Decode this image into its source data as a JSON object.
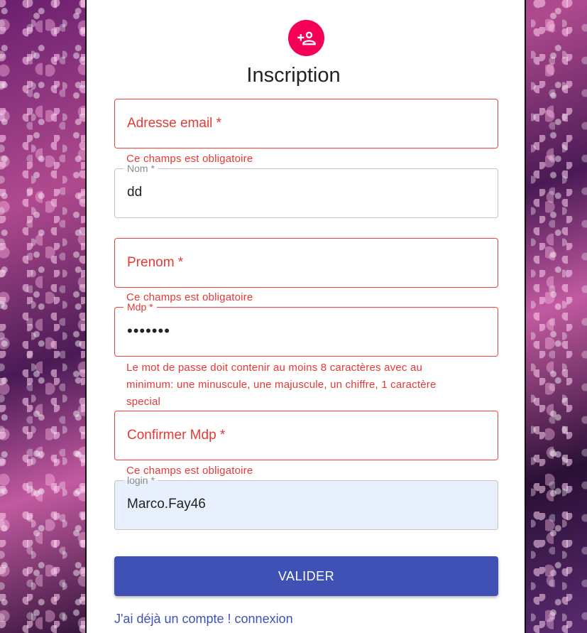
{
  "form": {
    "title": "Inscription",
    "icon": "person-add-icon",
    "email": {
      "placeholder": "Adresse email *",
      "error": "Ce champs est obligatoire"
    },
    "nom": {
      "label": "Nom *",
      "value": "dd"
    },
    "prenom": {
      "placeholder": "Prenom *",
      "error": "Ce champs est obligatoire"
    },
    "mdp": {
      "label": "Mdp *",
      "value": "•••••••",
      "error": "Le mot de passe doit contenir au moins 8 caractères avec au minimum: une minuscule, une majuscule, un chiffre, 1 caractère special"
    },
    "confirm_mdp": {
      "placeholder": "Confirmer Mdp *",
      "error": "Ce champs est obligatoire"
    },
    "login": {
      "label": "login *",
      "value": "Marco.Fay46"
    },
    "submit_label": "VALIDER",
    "login_link": "J'ai déjà un compte ! connexion"
  },
  "colors": {
    "accent_pink": "#f50057",
    "primary": "#3f51b5",
    "error": "#f44336",
    "autofill_bg": "#e8f0fe"
  }
}
